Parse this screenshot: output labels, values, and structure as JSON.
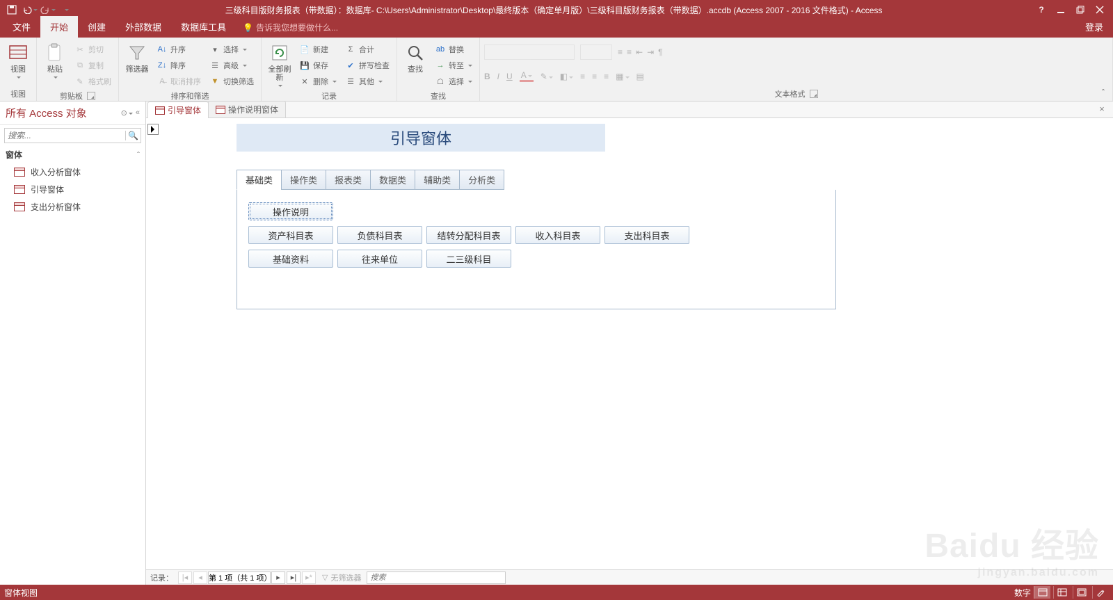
{
  "titlebar": {
    "title": "三级科目版财务报表（带数据）：数据库- C:\\Users\\Administrator\\Desktop\\最终版本（确定单月版）\\三级科目版财务报表（带数据）.accdb (Access 2007 - 2016 文件格式) - Access"
  },
  "ribbontabs": {
    "file": "文件",
    "home": "开始",
    "create": "创建",
    "external": "外部数据",
    "dbtools": "数据库工具",
    "tellme": "告诉我您想要做什么...",
    "login": "登录"
  },
  "ribbon": {
    "view_group": "视图",
    "view": "视图",
    "clipboard_group": "剪贴板",
    "paste": "粘贴",
    "cut": "剪切",
    "copy": "复制",
    "format_painter": "格式刷",
    "sortfilter_group": "排序和筛选",
    "filter": "筛选器",
    "asc": "升序",
    "desc": "降序",
    "remove_sort": "取消排序",
    "selection": "选择",
    "advanced": "高级",
    "toggle_filter": "切换筛选",
    "records_group": "记录",
    "refresh_all": "全部刷新",
    "new": "新建",
    "save": "保存",
    "delete": "删除",
    "totals": "合计",
    "spelling": "拼写检查",
    "more": "其他",
    "find_group": "查找",
    "find": "查找",
    "replace": "替换",
    "goto": "转至",
    "select": "选择",
    "textfmt_group": "文本格式"
  },
  "navpane": {
    "header": "所有 Access 对象",
    "search_ph": "搜索...",
    "group_forms": "窗体",
    "items": [
      "收入分析窗体",
      "引导窗体",
      "支出分析窗体"
    ]
  },
  "doctabs": {
    "tab1": "引导窗体",
    "tab2": "操作说明窗体"
  },
  "form": {
    "title": "引导窗体",
    "tabs": [
      "基础类",
      "操作类",
      "报表类",
      "数据类",
      "辅助类",
      "分析类"
    ],
    "row1": [
      "操作说明"
    ],
    "row2": [
      "资产科目表",
      "负债科目表",
      "结转分配科目表",
      "收入科目表",
      "支出科目表"
    ],
    "row3": [
      "基础资料",
      "往来单位",
      "二三级科目"
    ]
  },
  "recnav": {
    "label": "记录：",
    "position": "第 1 项（共 1 项）",
    "nofilter": "无筛选器",
    "search_ph": "搜索"
  },
  "statusbar": {
    "left": "窗体视图",
    "numlock": "数字"
  },
  "watermark": {
    "main": "Baidu 经验",
    "sub": "jingyan.baidu.com"
  }
}
